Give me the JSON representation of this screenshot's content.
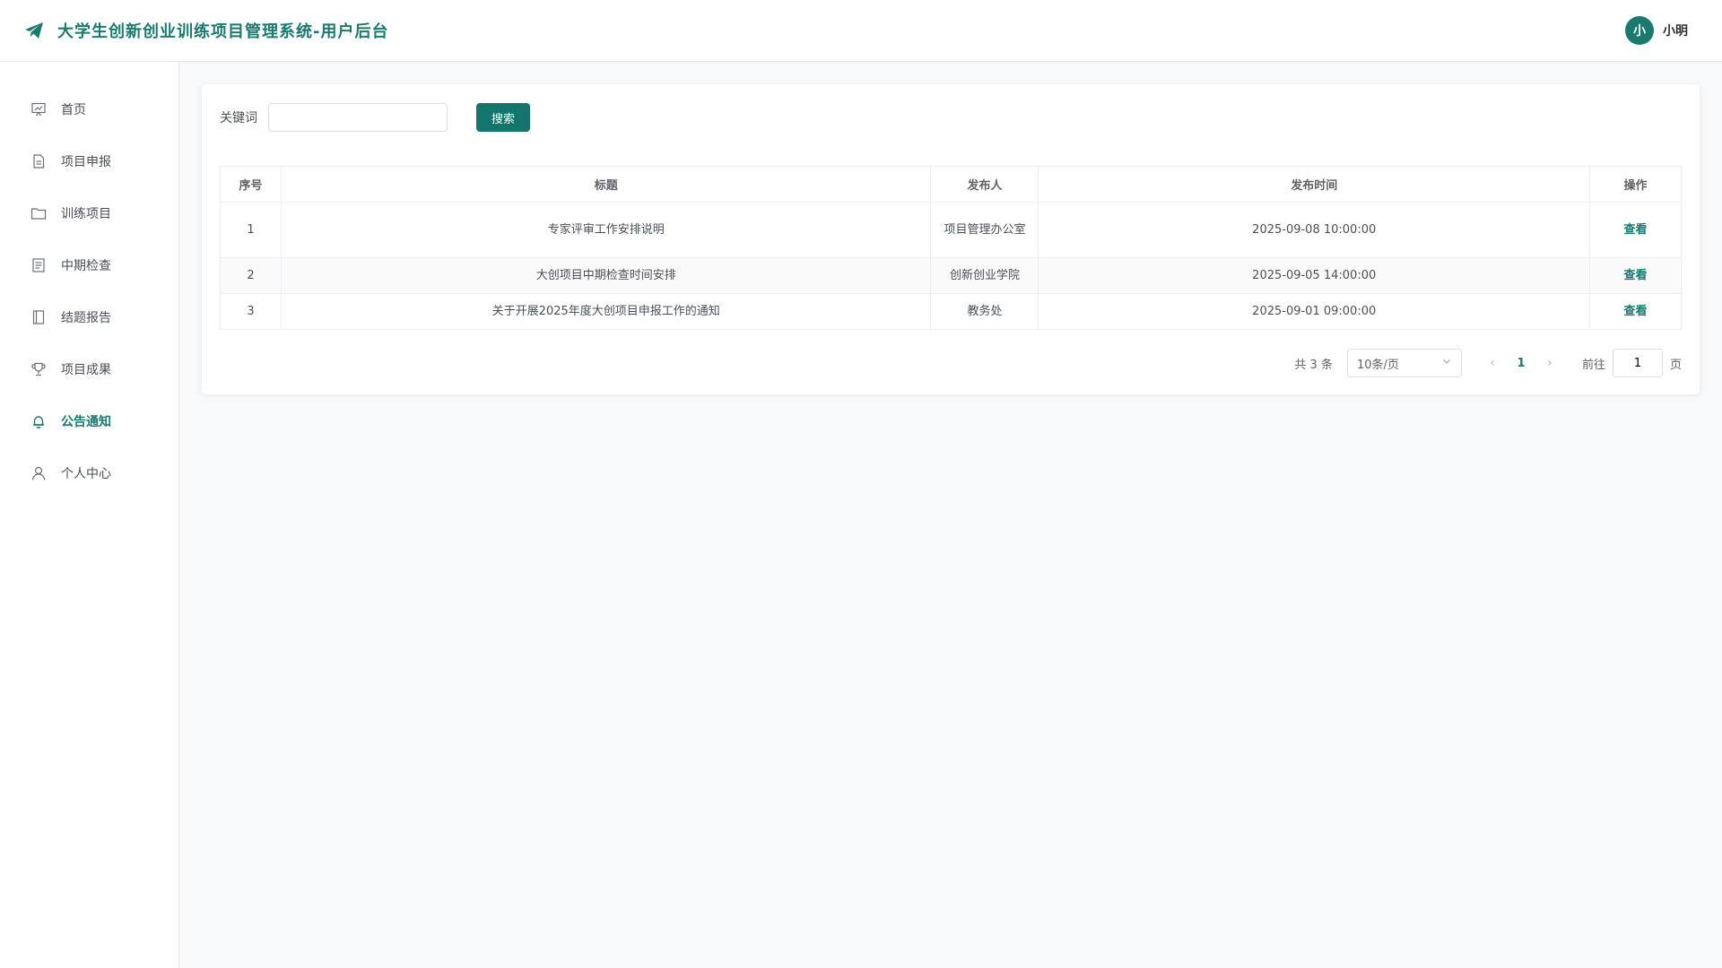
{
  "colors": {
    "brand": "#1a7a6e",
    "accent_button": "#13756b"
  },
  "header": {
    "logo_icon": "paper-plane-icon",
    "title": "大学生创新创业训练项目管理系统-用户后台",
    "avatar_text": "小",
    "user_name": "小明"
  },
  "sidebar": {
    "items": [
      {
        "label": "首页",
        "icon": "presentation-chart-icon",
        "active": false
      },
      {
        "label": "项目申报",
        "icon": "document-icon",
        "active": false
      },
      {
        "label": "训练项目",
        "icon": "folder-icon",
        "active": false
      },
      {
        "label": "中期检查",
        "icon": "checklist-icon",
        "active": false
      },
      {
        "label": "结题报告",
        "icon": "notebook-icon",
        "active": false
      },
      {
        "label": "项目成果",
        "icon": "trophy-icon",
        "active": false
      },
      {
        "label": "公告通知",
        "icon": "bell-icon",
        "active": true
      },
      {
        "label": "个人中心",
        "icon": "user-icon",
        "active": false
      }
    ]
  },
  "search": {
    "label": "关键词",
    "value": "",
    "placeholder": "",
    "button": "搜索"
  },
  "table": {
    "columns": [
      "序号",
      "标题",
      "发布人",
      "发布时间",
      "操作"
    ],
    "rows": [
      {
        "index": "1",
        "title": "专家评审工作安排说明",
        "publisher": "项目管理办公室",
        "time": "2025-09-08 10:00:00",
        "action": "查看"
      },
      {
        "index": "2",
        "title": "大创项目中期检查时间安排",
        "publisher": "创新创业学院",
        "time": "2025-09-05 14:00:00",
        "action": "查看"
      },
      {
        "index": "3",
        "title": "关于开展2025年度大创项目申报工作的通知",
        "publisher": "教务处",
        "time": "2025-09-01 09:00:00",
        "action": "查看"
      }
    ]
  },
  "pagination": {
    "total_text": "共 3 条",
    "page_size": "10条/页",
    "current_page": "1",
    "goto_label": "前往",
    "goto_value": "1",
    "page_suffix": "页"
  }
}
